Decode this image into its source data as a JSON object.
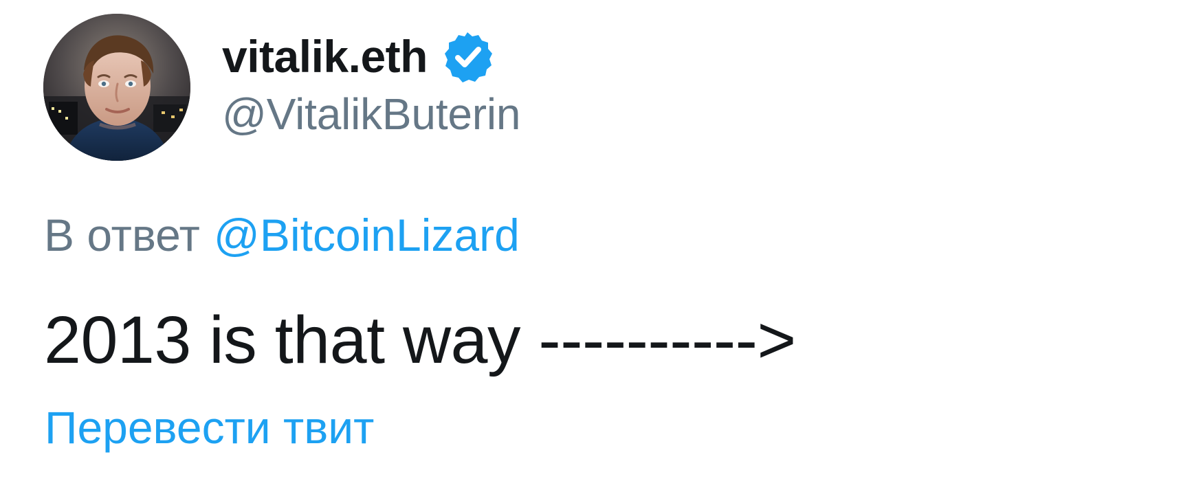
{
  "profile": {
    "display_name": "vitalik.eth",
    "handle": "@VitalikButerin",
    "verified_icon": "verified-badge-icon",
    "avatar_icon": "profile-photo"
  },
  "reply": {
    "prefix": "В ответ",
    "mention": "@BitcoinLizard"
  },
  "tweet": {
    "text": "2013 is that way ---------->"
  },
  "actions": {
    "translate": "Перевести твит"
  },
  "colors": {
    "primary_text": "#14171a",
    "secondary_text": "#657786",
    "link": "#1da1f2",
    "background": "#ffffff"
  }
}
